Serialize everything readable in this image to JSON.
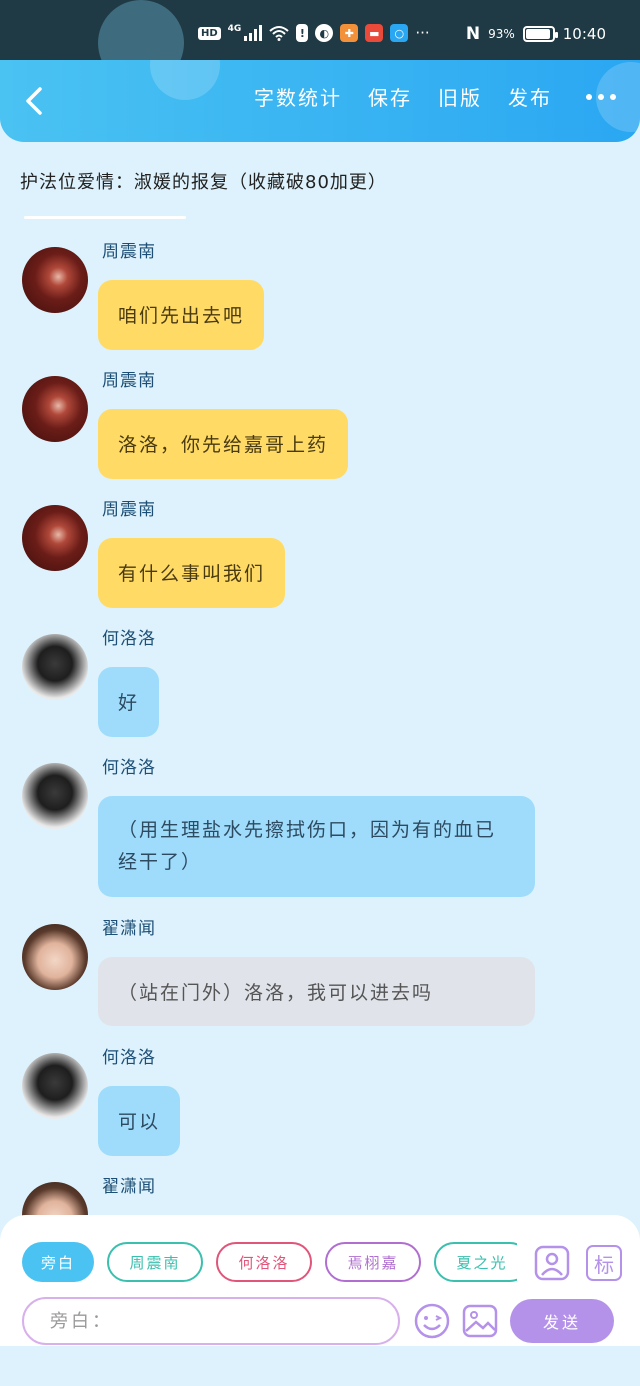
{
  "status_bar": {
    "hd": "HD",
    "network": "4G",
    "battery_percent": "93%",
    "battery_level": 0.93,
    "time": "10:40",
    "nfc_label": "N",
    "more": "···"
  },
  "header": {
    "actions": [
      "字数统计",
      "保存",
      "旧版",
      "发布"
    ]
  },
  "story": {
    "title": "护法位爱情：淑媛的报复（收藏破80加更）"
  },
  "messages": [
    {
      "speaker": "周震南",
      "text": "咱们先出去吧",
      "style": "yellow",
      "avatar": "red"
    },
    {
      "speaker": "周震南",
      "text": "洛洛，你先给嘉哥上药",
      "style": "yellow",
      "avatar": "red"
    },
    {
      "speaker": "周震南",
      "text": "有什么事叫我们",
      "style": "yellow",
      "avatar": "red"
    },
    {
      "speaker": "何洛洛",
      "text": "好",
      "style": "blue",
      "avatar": "bw"
    },
    {
      "speaker": "何洛洛",
      "text": "（用生理盐水先擦拭伤口，因为有的血已经干了）",
      "style": "blue",
      "avatar": "bw"
    },
    {
      "speaker": "翟潇闻",
      "text": "（站在门外）洛洛，我可以进去吗",
      "style": "gray",
      "avatar": "face"
    },
    {
      "speaker": "何洛洛",
      "text": "可以",
      "style": "blue",
      "avatar": "bw"
    },
    {
      "speaker": "翟潇闻",
      "text": "",
      "style": "gray",
      "avatar": "face"
    }
  ],
  "composer": {
    "roles": [
      {
        "label": "旁白",
        "color": "#4ac2f2",
        "active": true
      },
      {
        "label": "周震南",
        "color": "#3bbfae",
        "active": false
      },
      {
        "label": "何洛洛",
        "color": "#e0567a",
        "active": false
      },
      {
        "label": "焉栩嘉",
        "color": "#b06fd0",
        "active": false
      },
      {
        "label": "夏之光",
        "color": "#3bbfae",
        "active": false
      }
    ],
    "mark_label": "标",
    "input_placeholder": "旁白：",
    "send_label": "发送"
  },
  "colors": {
    "header_start": "#4ac2f2",
    "header_end": "#2aa7f2",
    "page_bg": "#ddf2fc",
    "yellow_bubble": "#ffdb66",
    "blue_bubble": "#9fdcfb",
    "gray_bubble": "#e0e4ea",
    "send": "#b592ea"
  }
}
